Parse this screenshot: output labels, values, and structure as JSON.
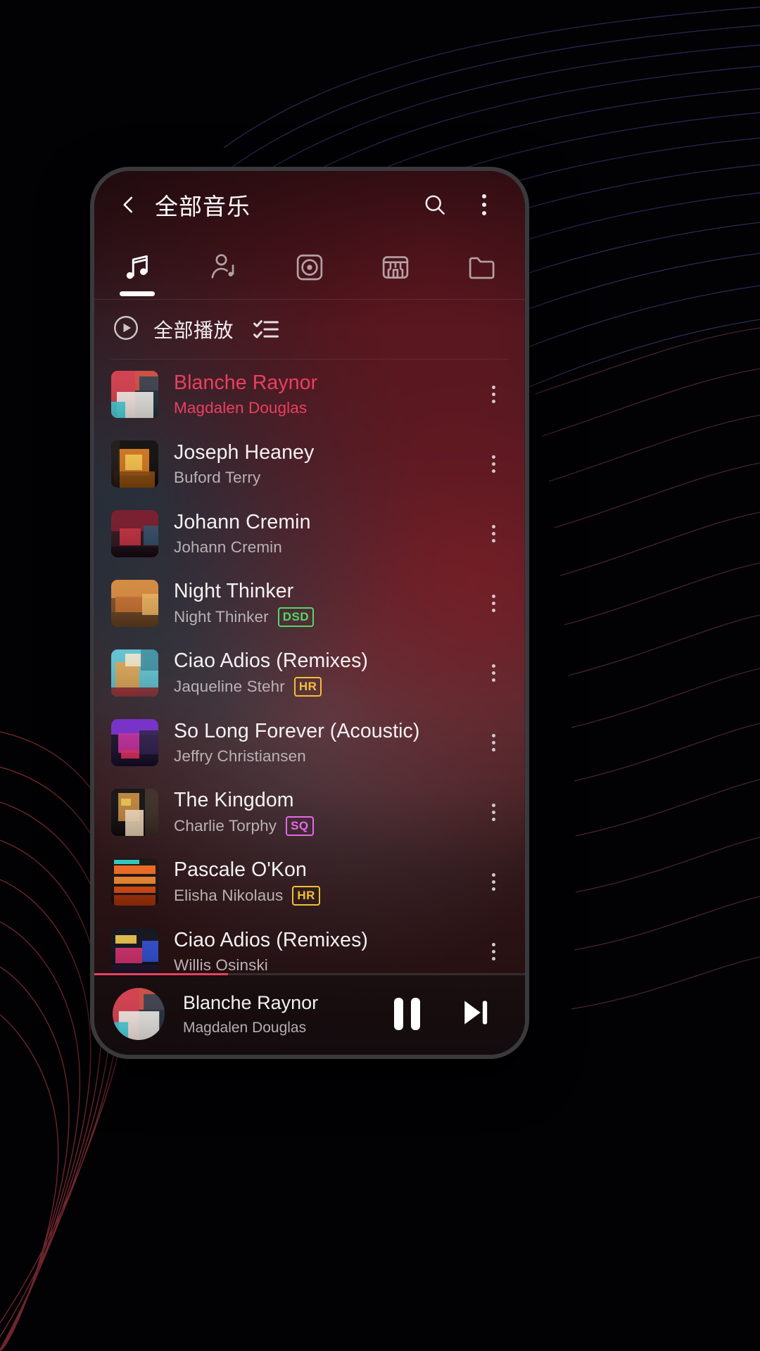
{
  "theme": {
    "accent": "#ec3f5f",
    "badge_dsd": "#4ed96b",
    "badge_hr": "#f2c033",
    "badge_sq": "#e967ee",
    "text_primary": "#f4f1f2",
    "text_secondary": "#b9b2b5"
  },
  "appbar": {
    "back_icon": "chevron-left-icon",
    "title": "全部音乐",
    "search_icon": "search-icon",
    "overflow_icon": "more-vertical-icon"
  },
  "tabs": [
    {
      "name": "songs",
      "icon": "music-note-icon",
      "active": true
    },
    {
      "name": "artists",
      "icon": "artist-icon",
      "active": false
    },
    {
      "name": "albums",
      "icon": "album-disc-icon",
      "active": false
    },
    {
      "name": "genres",
      "icon": "piano-keys-icon",
      "active": false
    },
    {
      "name": "folders",
      "icon": "folder-icon",
      "active": false
    }
  ],
  "playall": {
    "icon": "play-circle-icon",
    "label": "全部播放",
    "list_icon": "checklist-icon"
  },
  "tracks": [
    {
      "title": "Blanche Raynor",
      "artist": "Magdalen Douglas",
      "badge": "",
      "playing": true,
      "art": "a1"
    },
    {
      "title": "Joseph Heaney",
      "artist": "Buford Terry",
      "badge": "",
      "playing": false,
      "art": "a2"
    },
    {
      "title": "Johann Cremin",
      "artist": "Johann Cremin",
      "badge": "",
      "playing": false,
      "art": "a3"
    },
    {
      "title": "Night Thinker",
      "artist": "Night Thinker",
      "badge": "DSD",
      "playing": false,
      "art": "a4"
    },
    {
      "title": "Ciao Adios (Remixes)",
      "artist": "Jaqueline Stehr",
      "badge": "HR",
      "playing": false,
      "art": "a5"
    },
    {
      "title": "So Long Forever (Acoustic)",
      "artist": "Jeffry Christiansen",
      "badge": "",
      "playing": false,
      "art": "a6"
    },
    {
      "title": "The Kingdom",
      "artist": "Charlie Torphy",
      "badge": "SQ",
      "playing": false,
      "art": "a7"
    },
    {
      "title": "Pascale O'Kon",
      "artist": "Elisha Nikolaus",
      "badge": "HR",
      "playing": false,
      "art": "a8"
    },
    {
      "title": "Ciao Adios (Remixes)",
      "artist": "Willis Osinski",
      "badge": "",
      "playing": false,
      "art": "a9"
    }
  ],
  "miniplayer": {
    "title": "Blanche Raynor",
    "artist": "Magdalen Douglas",
    "progress_percent": 31,
    "pause_icon": "pause-icon",
    "next_icon": "skip-next-icon",
    "art": "a1"
  }
}
